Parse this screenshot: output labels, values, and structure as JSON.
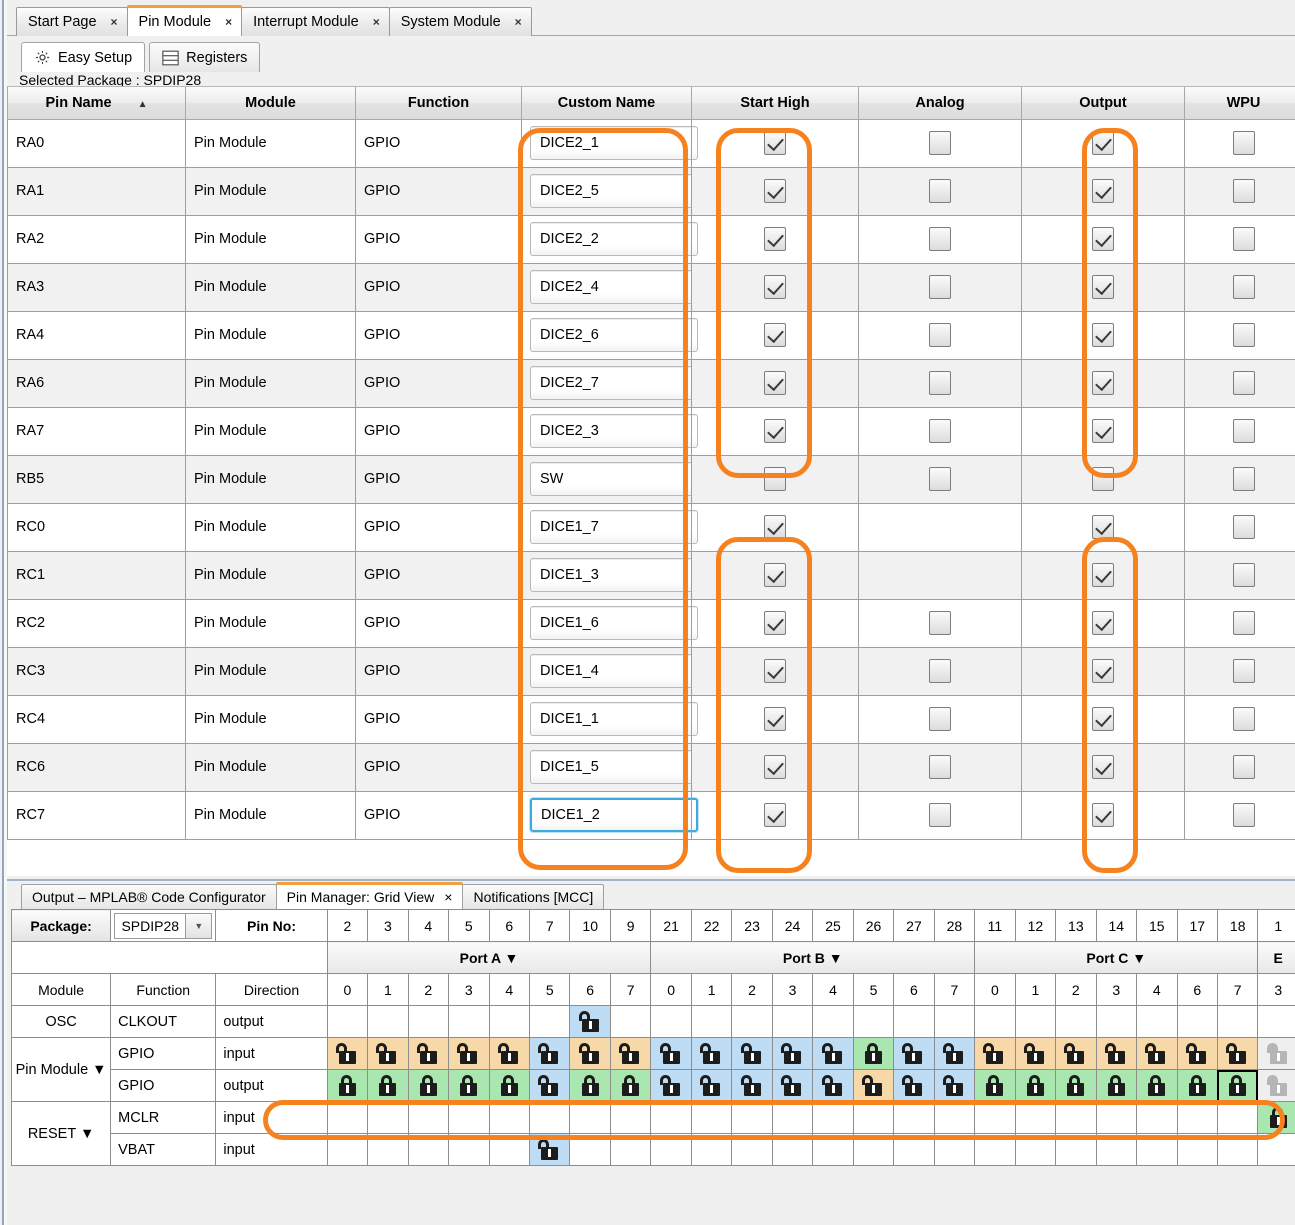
{
  "window": {
    "document_tabs": [
      {
        "label": "Start Page",
        "close": "×",
        "active": false
      },
      {
        "label": "Pin Module",
        "close": "×",
        "active": true
      },
      {
        "label": "Interrupt Module",
        "close": "×",
        "active": false
      },
      {
        "label": "System Module",
        "close": "×",
        "active": false
      }
    ],
    "inner_tabs": [
      {
        "label": "Easy Setup",
        "icon": "gear-icon",
        "active": true
      },
      {
        "label": "Registers",
        "icon": "registers-icon",
        "active": false
      }
    ],
    "package_line": "Selected Package : SPDIP28"
  },
  "pin_table": {
    "columns": [
      "Pin Name",
      "Module",
      "Function",
      "Custom Name",
      "Start High",
      "Analog",
      "Output",
      "WPU"
    ],
    "sort_indicator": "▲",
    "rows": [
      {
        "pin": "RA0",
        "module": "Pin Module",
        "function": "GPIO",
        "custom": "DICE2_1",
        "start_high": true,
        "analog": false,
        "analog_present": true,
        "output": true,
        "wpu": false,
        "focused": false
      },
      {
        "pin": "RA1",
        "module": "Pin Module",
        "function": "GPIO",
        "custom": "DICE2_5",
        "start_high": true,
        "analog": false,
        "analog_present": true,
        "output": true,
        "wpu": false,
        "focused": false
      },
      {
        "pin": "RA2",
        "module": "Pin Module",
        "function": "GPIO",
        "custom": "DICE2_2",
        "start_high": true,
        "analog": false,
        "analog_present": true,
        "output": true,
        "wpu": false,
        "focused": false
      },
      {
        "pin": "RA3",
        "module": "Pin Module",
        "function": "GPIO",
        "custom": "DICE2_4",
        "start_high": true,
        "analog": false,
        "analog_present": true,
        "output": true,
        "wpu": false,
        "focused": false
      },
      {
        "pin": "RA4",
        "module": "Pin Module",
        "function": "GPIO",
        "custom": "DICE2_6",
        "start_high": true,
        "analog": false,
        "analog_present": true,
        "output": true,
        "wpu": false,
        "focused": false
      },
      {
        "pin": "RA6",
        "module": "Pin Module",
        "function": "GPIO",
        "custom": "DICE2_7",
        "start_high": true,
        "analog": false,
        "analog_present": true,
        "output": true,
        "wpu": false,
        "focused": false
      },
      {
        "pin": "RA7",
        "module": "Pin Module",
        "function": "GPIO",
        "custom": "DICE2_3",
        "start_high": true,
        "analog": false,
        "analog_present": true,
        "output": true,
        "wpu": false,
        "focused": false
      },
      {
        "pin": "RB5",
        "module": "Pin Module",
        "function": "GPIO",
        "custom": "SW",
        "start_high": false,
        "analog": false,
        "analog_present": true,
        "output": false,
        "wpu": false,
        "focused": false
      },
      {
        "pin": "RC0",
        "module": "Pin Module",
        "function": "GPIO",
        "custom": "DICE1_7",
        "start_high": true,
        "analog": false,
        "analog_present": false,
        "output": true,
        "wpu": false,
        "focused": false
      },
      {
        "pin": "RC1",
        "module": "Pin Module",
        "function": "GPIO",
        "custom": "DICE1_3",
        "start_high": true,
        "analog": false,
        "analog_present": false,
        "output": true,
        "wpu": false,
        "focused": false
      },
      {
        "pin": "RC2",
        "module": "Pin Module",
        "function": "GPIO",
        "custom": "DICE1_6",
        "start_high": true,
        "analog": false,
        "analog_present": true,
        "output": true,
        "wpu": false,
        "focused": false
      },
      {
        "pin": "RC3",
        "module": "Pin Module",
        "function": "GPIO",
        "custom": "DICE1_4",
        "start_high": true,
        "analog": false,
        "analog_present": true,
        "output": true,
        "wpu": false,
        "focused": false
      },
      {
        "pin": "RC4",
        "module": "Pin Module",
        "function": "GPIO",
        "custom": "DICE1_1",
        "start_high": true,
        "analog": false,
        "analog_present": true,
        "output": true,
        "wpu": false,
        "focused": false
      },
      {
        "pin": "RC6",
        "module": "Pin Module",
        "function": "GPIO",
        "custom": "DICE1_5",
        "start_high": true,
        "analog": false,
        "analog_present": true,
        "output": true,
        "wpu": false,
        "focused": false
      },
      {
        "pin": "RC7",
        "module": "Pin Module",
        "function": "GPIO",
        "custom": "DICE1_2",
        "start_high": true,
        "analog": false,
        "analog_present": true,
        "output": true,
        "wpu": false,
        "focused": true
      }
    ]
  },
  "bottom_panel": {
    "tabs": [
      {
        "label": "Output – MPLAB® Code Configurator",
        "active": false,
        "closable": false
      },
      {
        "label": "Pin Manager: Grid View",
        "active": true,
        "closable": true,
        "close": "×"
      },
      {
        "label": "Notifications [MCC]",
        "active": false,
        "closable": false
      }
    ],
    "package_label": "Package:",
    "package_value": "SPDIP28",
    "pin_no_label": "Pin No:",
    "pin_numbers": [
      "2",
      "3",
      "4",
      "5",
      "6",
      "7",
      "10",
      "9",
      "21",
      "22",
      "23",
      "24",
      "25",
      "26",
      "27",
      "28",
      "11",
      "12",
      "13",
      "14",
      "15",
      "17",
      "18",
      "1"
    ],
    "ports": [
      {
        "label": "Port A ▼",
        "span": 8
      },
      {
        "label": "Port B ▼",
        "span": 8
      },
      {
        "label": "Port C ▼",
        "span": 7
      },
      {
        "label": "E",
        "span": 1
      }
    ],
    "sub_headers": [
      "Module",
      "Function",
      "Direction"
    ],
    "bit_numbers": [
      "0",
      "1",
      "2",
      "3",
      "4",
      "5",
      "6",
      "7",
      "0",
      "1",
      "2",
      "3",
      "4",
      "5",
      "6",
      "7",
      "0",
      "1",
      "2",
      "3",
      "4",
      "6",
      "7",
      "3"
    ],
    "rows": [
      {
        "module": "OSC",
        "module_rowspan": 1,
        "function": "CLKOUT",
        "direction": "output",
        "cells": [
          "",
          "",
          "",
          "",
          "",
          "",
          "blue-open",
          "",
          "",
          "",
          "",
          "",
          "",
          "",
          "",
          "",
          "",
          "",
          "",
          "",
          "",
          "",
          "",
          ""
        ]
      },
      {
        "module": "Pin Module ▼",
        "module_rowspan": 2,
        "function": "GPIO",
        "direction": "input",
        "cells": [
          "tan-open",
          "tan-open",
          "tan-open",
          "tan-open",
          "tan-open",
          "blue-open",
          "tan-open",
          "tan-open",
          "blue-open",
          "blue-open",
          "blue-open",
          "blue-open",
          "blue-open",
          "green-closed",
          "blue-open",
          "blue-open",
          "tan-open",
          "tan-open",
          "tan-open",
          "tan-open",
          "tan-open",
          "tan-open",
          "tan-open",
          "dis-open"
        ]
      },
      {
        "module": "",
        "module_rowspan": 0,
        "function": "GPIO",
        "direction": "output",
        "cells": [
          "green-closed",
          "green-closed",
          "green-closed",
          "green-closed",
          "green-closed",
          "blue-open",
          "green-closed",
          "green-closed",
          "blue-open",
          "blue-open",
          "blue-open",
          "blue-open",
          "blue-open",
          "tan-open",
          "blue-open",
          "blue-open",
          "green-closed",
          "green-closed",
          "green-closed",
          "green-closed",
          "green-closed",
          "green-closed",
          "green-closed-sel",
          "dis-open"
        ]
      },
      {
        "module": "RESET ▼",
        "module_rowspan": 2,
        "function": "MCLR",
        "direction": "input",
        "cells": [
          "",
          "",
          "",
          "",
          "",
          "",
          "",
          "",
          "",
          "",
          "",
          "",
          "",
          "",
          "",
          "",
          "",
          "",
          "",
          "",
          "",
          "",
          "",
          "green-closed"
        ]
      },
      {
        "module": "",
        "module_rowspan": 0,
        "function": "VBAT",
        "direction": "input",
        "cells": [
          "",
          "",
          "",
          "",
          "",
          "blue-open",
          "",
          "",
          "",
          "",
          "",
          "",
          "",
          "",
          "",
          "",
          "",
          "",
          "",
          "",
          "",
          "",
          "",
          ""
        ]
      }
    ]
  },
  "annotations": {
    "accent_color": "#f5821f",
    "highlighted_columns": [
      "Custom Name",
      "Start High",
      "Output"
    ],
    "highlighted_row": "GPIO output"
  }
}
